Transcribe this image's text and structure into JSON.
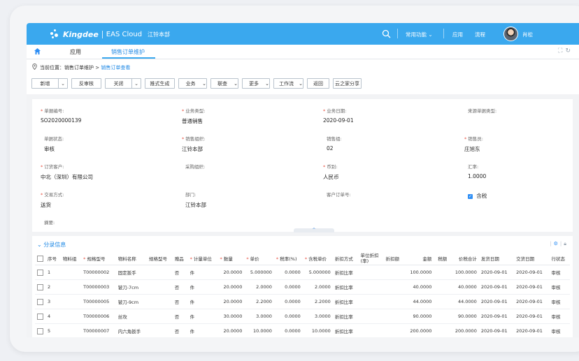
{
  "app": {
    "brand": "Kingdee",
    "product": "EAS Cloud",
    "company": "江铃本部",
    "menu": {
      "common": "常用功能",
      "apps": "应用",
      "flow": "流程"
    },
    "user": "肖松"
  },
  "tabs": [
    {
      "label": "应用"
    },
    {
      "label": "销售订单维护"
    }
  ],
  "breadcrumb": {
    "prefix": "当前位置：",
    "parent": "销售订单维护",
    "sep": " > ",
    "current": "销售订单查看"
  },
  "toolbar": {
    "add": "新增",
    "unaudit": "反审核",
    "close": "关闭",
    "push": "推式生成",
    "business": "业务",
    "query": "联查",
    "more": "更多",
    "workflow": "工作流",
    "back": "返回",
    "share": "云之家分享"
  },
  "header_fields": {
    "bill_no": {
      "label": "单据编号:",
      "value": "SO2020000139"
    },
    "biz_type": {
      "label": "业务类型:",
      "value": "普通销售"
    },
    "biz_date": {
      "label": "业务日期:",
      "value": "2020-09-01"
    },
    "source_type": {
      "label": "来源单据类型:",
      "value": ""
    },
    "status": {
      "label": "单据状态:",
      "value": "审核"
    },
    "sale_org": {
      "label": "销售组织:",
      "value": "江铃本部"
    },
    "sale_group": {
      "label": "销售组:",
      "value": "02"
    },
    "salesman": {
      "label": "销售员:",
      "value": "庄旭东"
    },
    "customer": {
      "label": "订货客户:",
      "value": "中北（深圳）有限公司"
    },
    "purchase_org": {
      "label": "采购组织:",
      "value": ""
    },
    "currency": {
      "label": "币别:",
      "value": "人民币"
    },
    "rate": {
      "label": "汇率:",
      "value": "1.0000"
    },
    "trade_mode": {
      "label": "交易方式:",
      "value": "送货"
    },
    "dept": {
      "label": "部门:",
      "value": "江铃本部"
    },
    "cust_order": {
      "label": "客户订单号:",
      "value": ""
    },
    "tax_incl": {
      "label": "含税"
    },
    "remark": {
      "label": "摘要:"
    }
  },
  "entries": {
    "title": "分录信息",
    "columns": [
      "序号",
      "物料组",
      "规格型号",
      "物料名称",
      "规格型号",
      "赠品",
      "计量单位",
      "数量",
      "单价",
      "税率(%)",
      "含税单价",
      "折扣方式",
      "单位折扣(率)",
      "折扣额",
      "金额",
      "税额",
      "价税合计",
      "发货日期",
      "交货日期",
      "行状态"
    ],
    "rows": [
      [
        "1",
        "",
        "T00000002",
        "固定扳手",
        "",
        "否",
        "件",
        "20.0000",
        "5.000000",
        "0.0000",
        "5.000000",
        "折扣比率",
        "",
        "",
        "100.0000",
        "",
        "100.0000",
        "2020-09-01",
        "2020-09-01",
        "审核"
      ],
      [
        "2",
        "",
        "T00000003",
        "铍刀-7cm",
        "",
        "否",
        "件",
        "20.0000",
        "2.0000",
        "0.0000",
        "2.0000",
        "折扣比率",
        "",
        "",
        "40.0000",
        "",
        "40.0000",
        "2020-09-01",
        "2020-09-01",
        "审核"
      ],
      [
        "3",
        "",
        "T00000005",
        "铍刀-9cm",
        "",
        "否",
        "件",
        "20.0000",
        "2.2000",
        "0.0000",
        "2.2000",
        "折扣比率",
        "",
        "",
        "44.0000",
        "",
        "44.0000",
        "2020-09-01",
        "2020-09-01",
        "审核"
      ],
      [
        "4",
        "",
        "T00000006",
        "丝攻",
        "",
        "否",
        "件",
        "30.0000",
        "3.0000",
        "0.0000",
        "3.0000",
        "折扣比率",
        "",
        "",
        "90.0000",
        "",
        "90.0000",
        "2020-09-01",
        "2020-09-01",
        "审核"
      ],
      [
        "5",
        "",
        "T00000007",
        "内六角扳手",
        "",
        "否",
        "件",
        "20.0000",
        "10.0000",
        "0.0000",
        "10.0000",
        "折扣比率",
        "",
        "",
        "200.0000",
        "",
        "200.0000",
        "2020-09-01",
        "2020-09-01",
        "审核"
      ]
    ]
  },
  "colors": {
    "primary": "#3aa8ee",
    "link": "#1e88e5",
    "required": "#e74c3c"
  },
  "icons": [
    "home-icon",
    "search-icon",
    "location-pin-icon",
    "expand-icon",
    "refresh-icon",
    "settings-icon",
    "lock-icon"
  ]
}
